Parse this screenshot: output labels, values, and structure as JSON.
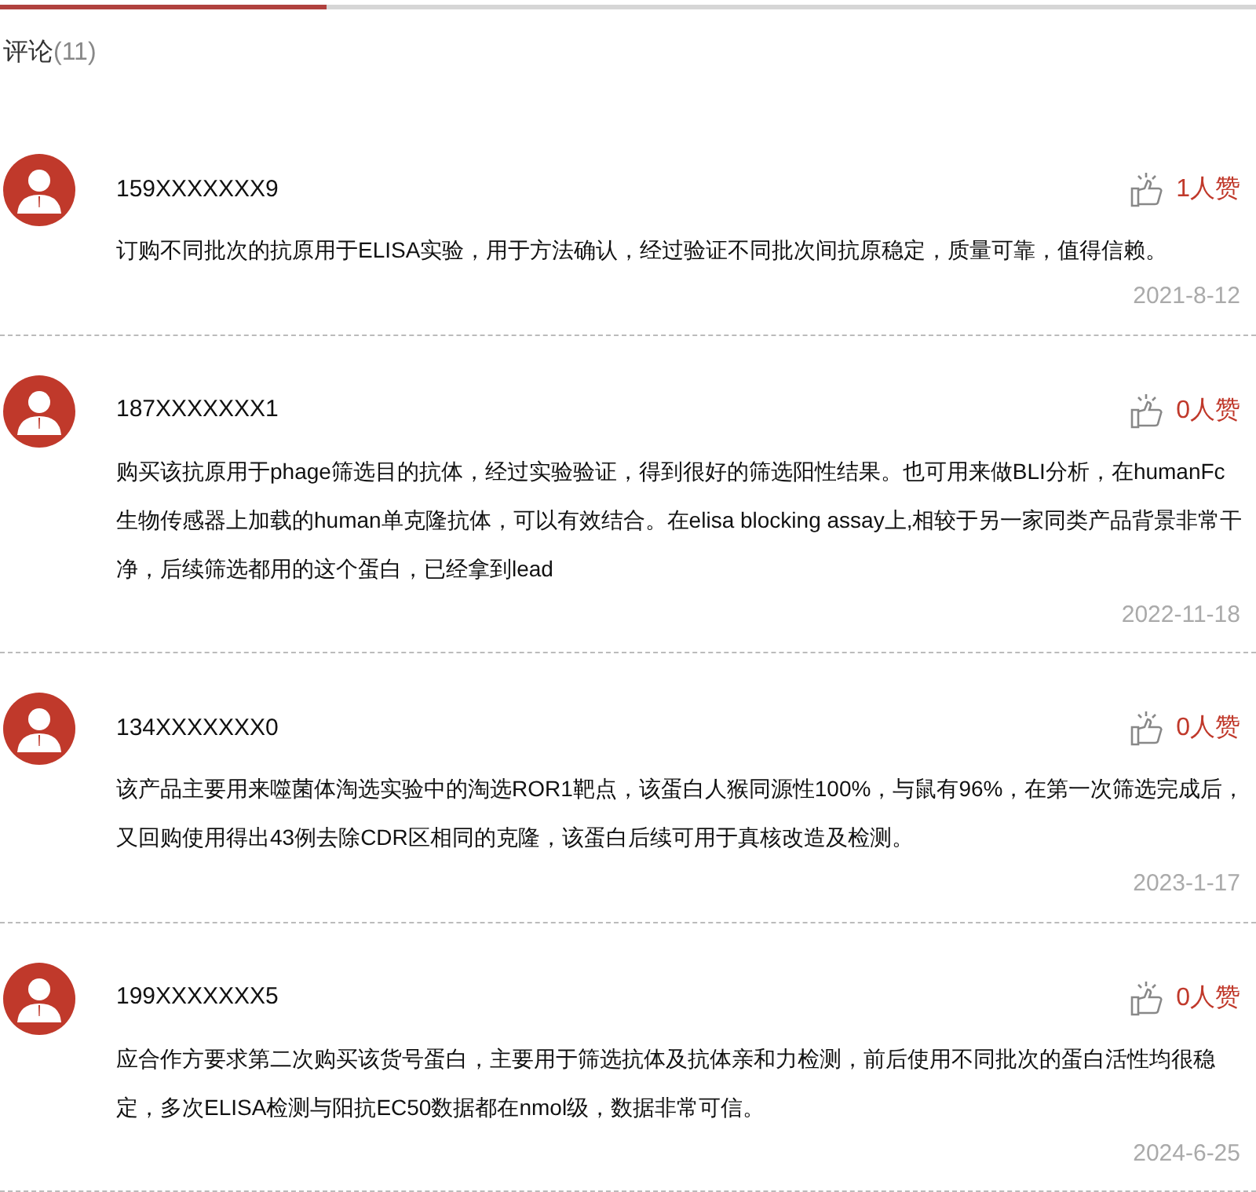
{
  "header": {
    "title": "评论",
    "count": "(11)"
  },
  "comments": [
    {
      "user": "159XXXXXXX9",
      "likes": "1人赞",
      "text": "订购不同批次的抗原用于ELISA实验，用于方法确认，经过验证不同批次间抗原稳定，质量可靠，值得信赖。",
      "date": "2021-8-12"
    },
    {
      "user": "187XXXXXXX1",
      "likes": "0人赞",
      "text": "购买该抗原用于phage筛选目的抗体，经过实验验证，得到很好的筛选阳性结果。也可用来做BLI分析，在humanFc生物传感器上加载的human单克隆抗体，可以有效结合。在elisa blocking assay上,相较于另一家同类产品背景非常干净，后续筛选都用的这个蛋白，已经拿到lead",
      "date": "2022-11-18"
    },
    {
      "user": "134XXXXXXX0",
      "likes": "0人赞",
      "text": "该产品主要用来噬菌体淘选实验中的淘选ROR1靶点，该蛋白人猴同源性100%，与鼠有96%，在第一次筛选完成后，又回购使用得出43例去除CDR区相同的克隆，该蛋白后续可用于真核改造及检测。",
      "date": "2023-1-17"
    },
    {
      "user": "199XXXXXXX5",
      "likes": "0人赞",
      "text": "应合作方要求第二次购买该货号蛋白，主要用于筛选抗体及抗体亲和力检测，前后使用不同批次的蛋白活性均很稳定，多次ELISA检测与阳抗EC50数据都在nmol级，数据非常可信。",
      "date": "2024-6-25"
    }
  ]
}
